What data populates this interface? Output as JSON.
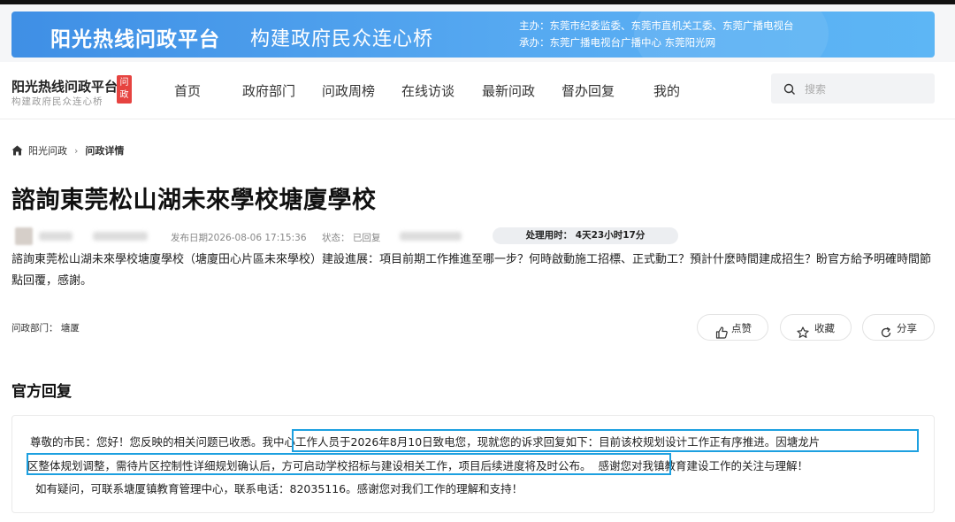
{
  "banner": {
    "title": "阳光热线问政平台",
    "subtitle": "构建政府民众连心桥",
    "sponsor": "主办：东莞市纪委监委、东莞市直机关工委、东莞广播电视台",
    "organizer": "承办：东莞广播电视台广播中心 东莞阳光网"
  },
  "header": {
    "logo_main": "阳光热线问政平台",
    "logo_sub": "构建政府民众连心桥",
    "logo_badge": "问政",
    "nav": [
      "首页",
      "政府部门",
      "问政周榜",
      "在线访谈",
      "最新问政",
      "督办回复",
      "我的"
    ],
    "search_placeholder": "搜索"
  },
  "breadcrumb": {
    "home": "阳光问政",
    "current": "问政详情"
  },
  "post": {
    "title": "諮詢東莞松山湖未來學校塘廈學校",
    "publish_date": "发布日期2026-08-06 17:15:36",
    "status": "状态： 已回复",
    "processing_time": "处理用时： 4天23小时17分",
    "content": "諮詢東莞松山湖未來學校塘廈學校（塘廈田心片區未來學校）建設進展：項目前期工作推進至哪一步？何時啟動施工招標、正式動工？預計什麼時間建成招生？盼官方給予明確時間節點回覆，感謝。",
    "department": "问政部门： 塘厦"
  },
  "actions": {
    "like": "点赞",
    "favorite": "收藏",
    "share": "分享"
  },
  "reply": {
    "section_title": "官方回复",
    "line1_a": "尊敬的市民：您好！您反映的相关问题已收悉。",
    "line1_b": "我中心工作人员于2026年8月10日致电您，现就您的诉求回复如下：目前该校规划设计工作正有序推进。因塘龙片",
    "line2_a": "区整体规划调整，需待片区控制性详细规划确认后，方可启动学校招标与建设相关工作，项目后续进度将及时公布。",
    "line2_b": "感谢您对我镇教育建设工作的关注与理解！",
    "line3": "如有疑问，可联系塘厦镇教育管理中心，联系电话：82035116。感谢您对我们工作的理解和支持！"
  },
  "colors": {
    "banner": "#4a9ceb",
    "highlight": "#1da0e0",
    "badge": "#e64340"
  }
}
